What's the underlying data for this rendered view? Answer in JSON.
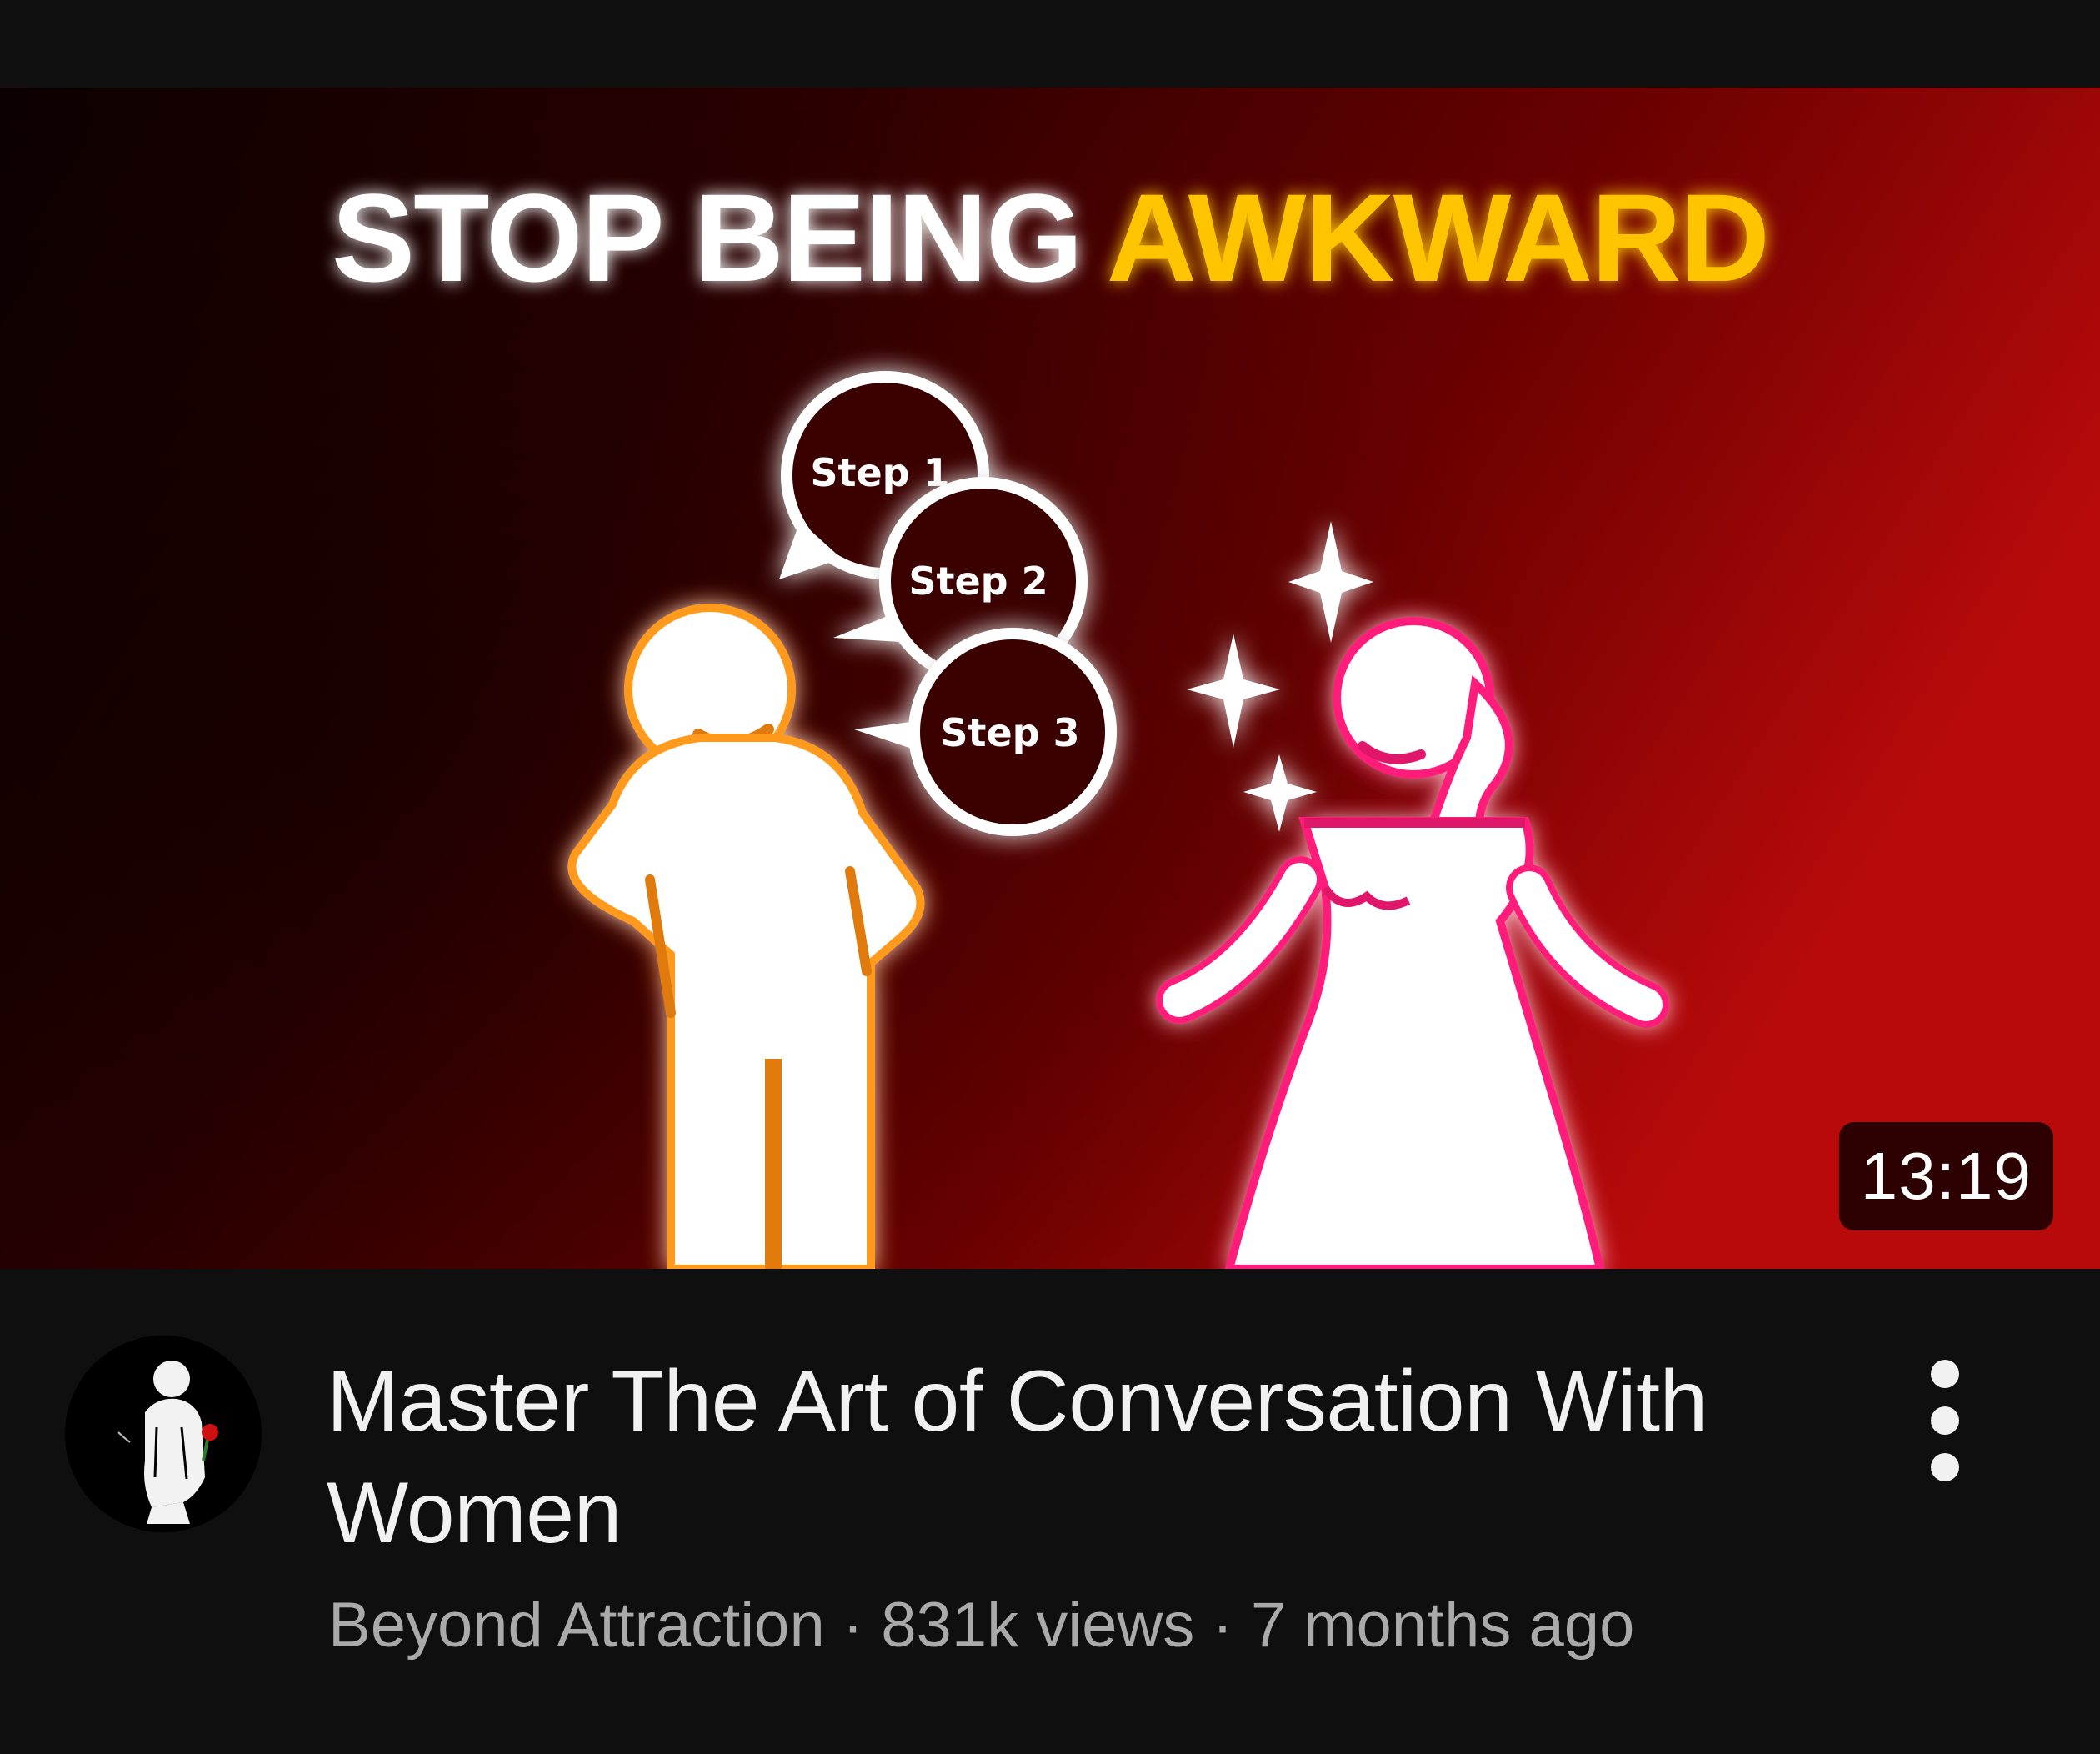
{
  "video": {
    "thumbnail": {
      "headline_white": "STOP BEING",
      "headline_accent": "AWKWARD",
      "bubble_1": "Step 1",
      "bubble_2": "Step 2",
      "bubble_3": "Step 3",
      "duration": "13:19",
      "colors": {
        "headline_accent": "#ffc400",
        "man_glow": "#ff9a1f",
        "woman_glow": "#ff1f7a",
        "background_dark": "#1a0000",
        "background_red": "#b00000"
      }
    },
    "title": "Master The Art of Conversation With Women",
    "channel": "Beyond Attraction",
    "separator": "·",
    "views": "831k views",
    "age": "7 months ago",
    "avatar_icon": "man-with-rose-icon",
    "more_icon": "more-vert-icon"
  }
}
